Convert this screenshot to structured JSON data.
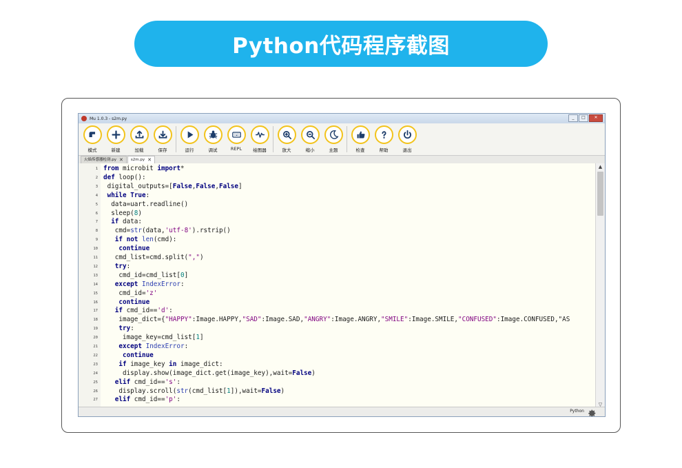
{
  "banner": {
    "title": "Python代码程序截图"
  },
  "window": {
    "title": "Mu 1.0.3 - s2m.py",
    "controls": [
      "_",
      "□",
      "✕"
    ],
    "toolbar": [
      {
        "label": "模式",
        "icon": "mode-icon"
      },
      {
        "label": "新建",
        "icon": "plus-icon"
      },
      {
        "label": "加载",
        "icon": "upload-icon"
      },
      {
        "label": "保存",
        "icon": "download-icon"
      },
      {
        "label": "运行",
        "icon": "play-icon"
      },
      {
        "label": "调试",
        "icon": "bug-icon"
      },
      {
        "label": "REPL",
        "icon": "keyboard-icon"
      },
      {
        "label": "绘图器",
        "icon": "pulse-icon"
      },
      {
        "label": "放大",
        "icon": "zoom-in-icon"
      },
      {
        "label": "缩小",
        "icon": "zoom-out-icon"
      },
      {
        "label": "主题",
        "icon": "moon-icon"
      },
      {
        "label": "检查",
        "icon": "thumbs-up-icon"
      },
      {
        "label": "帮助",
        "icon": "help-icon"
      },
      {
        "label": "退出",
        "icon": "power-icon"
      }
    ],
    "tabs": [
      {
        "label": "火焰传感器检测.py",
        "close": "✕",
        "active": false
      },
      {
        "label": "s2m.py",
        "close": "✕",
        "active": true
      }
    ],
    "status": {
      "mode": "Python"
    },
    "scroll": {
      "up": "▲",
      "down": "▽"
    }
  },
  "code": [
    {
      "n": "1",
      "t": "from microbit import*"
    },
    {
      "n": "2",
      "t": "def loop():"
    },
    {
      "n": "3",
      "t": " digital_outputs=[False,False,False]"
    },
    {
      "n": "4",
      "t": " while True:"
    },
    {
      "n": "5",
      "t": "  data=uart.readline()"
    },
    {
      "n": "6",
      "t": "  sleep(8)"
    },
    {
      "n": "7",
      "t": "  if data:"
    },
    {
      "n": "8",
      "t": "   cmd=str(data,'utf-8').rstrip()"
    },
    {
      "n": "9",
      "t": "   if not len(cmd):"
    },
    {
      "n": "10",
      "t": "    continue"
    },
    {
      "n": "11",
      "t": "   cmd_list=cmd.split(\",\")"
    },
    {
      "n": "12",
      "t": "   try:"
    },
    {
      "n": "13",
      "t": "    cmd_id=cmd_list[0]"
    },
    {
      "n": "14",
      "t": "   except IndexError:"
    },
    {
      "n": "15",
      "t": "    cmd_id='z'"
    },
    {
      "n": "16",
      "t": "    continue"
    },
    {
      "n": "17",
      "t": "   if cmd_id=='d':"
    },
    {
      "n": "18",
      "t": "    image_dict={\"HAPPY\":Image.HAPPY,\"SAD\":Image.SAD,\"ANGRY\":Image.ANGRY,\"SMILE\":Image.SMILE,\"CONFUSED\":Image.CONFUSED,\"AS"
    },
    {
      "n": "19",
      "t": "    try:"
    },
    {
      "n": "20",
      "t": "     image_key=cmd_list[1]"
    },
    {
      "n": "21",
      "t": "    except IndexError:"
    },
    {
      "n": "22",
      "t": "     continue"
    },
    {
      "n": "23",
      "t": "    if image_key in image_dict:"
    },
    {
      "n": "24",
      "t": "     display.show(image_dict.get(image_key),wait=False)"
    },
    {
      "n": "25",
      "t": "   elif cmd_id=='s':"
    },
    {
      "n": "26",
      "t": "    display.scroll(str(cmd_list[1]),wait=False)"
    },
    {
      "n": "27",
      "t": "   elif cmd_id=='p':"
    }
  ],
  "colors": {
    "accent": "#1fb3ec",
    "toolbar_ring": "#f2c31b",
    "icon": "#1d3d6b",
    "keyword": "#00007f",
    "string": "#7f007f"
  }
}
